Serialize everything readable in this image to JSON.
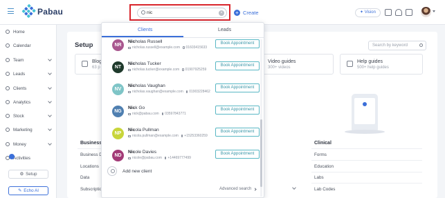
{
  "header": {
    "brand": "Pabau",
    "search_value": "nic",
    "create_label": "Create",
    "vision_label": "Vision"
  },
  "sidebar": {
    "items": [
      {
        "label": "Home",
        "icon": "home-icon",
        "chevron": false
      },
      {
        "label": "Calendar",
        "icon": "calendar-icon",
        "chevron": false
      },
      {
        "label": "Team",
        "icon": "team-icon",
        "chevron": true
      },
      {
        "label": "Leads",
        "icon": "leads-icon",
        "chevron": true
      },
      {
        "label": "Clients",
        "icon": "clients-icon",
        "chevron": true
      },
      {
        "label": "Analytics",
        "icon": "analytics-icon",
        "chevron": true
      },
      {
        "label": "Stock",
        "icon": "stock-icon",
        "chevron": true
      },
      {
        "label": "Marketing",
        "icon": "marketing-icon",
        "chevron": true
      },
      {
        "label": "Money",
        "icon": "money-icon",
        "chevron": true
      },
      {
        "label": "Activities",
        "icon": "activities-icon",
        "chevron": false
      }
    ],
    "activities_badge": "",
    "setup_label": "Setup",
    "echo_label": "Echo AI"
  },
  "main": {
    "title": "Setup",
    "search_placeholder": "Search by keyword",
    "cards": [
      {
        "title": "Blog",
        "subtitle": "63 p"
      },
      {
        "title": "Video guides",
        "subtitle": "300+ videos"
      },
      {
        "title": "Help guides",
        "subtitle": "500+ help guides"
      }
    ],
    "business": {
      "heading": "Business",
      "items": [
        "Business Det",
        "Locations",
        "Data",
        "Subscription"
      ]
    },
    "clinical": {
      "heading": "Clinical",
      "items": [
        "Forms",
        "Education",
        "Labs",
        "Lab Codes"
      ]
    }
  },
  "dropdown": {
    "tabs": [
      "Clients",
      "Leads"
    ],
    "active_tab": "Clients",
    "results": [
      {
        "initials": "NR",
        "color": "#a9578f",
        "match": "Nic",
        "rest": "holas Russell",
        "email": "nicholas.russell@example.com",
        "phone": "01603415633",
        "button": "Book Appointment"
      },
      {
        "initials": "NT",
        "color": "#1f3a2c",
        "match": "Nic",
        "rest": "holas Tucker",
        "email": "nicholas.tucker@example.com",
        "phone": "01907925259",
        "button": "Book Appointment"
      },
      {
        "initials": "NV",
        "color": "#7fc5c7",
        "match": "Nic",
        "rest": "holas Vaughan",
        "email": "nicholas.vaughan@example.com",
        "phone": "01903228462",
        "button": "Book Appointment"
      },
      {
        "initials": "NG",
        "color": "#4f7fb0",
        "match": "Nic",
        "rest": "k Go",
        "email": "nick@pabau.com",
        "phone": "03597843771",
        "button": "Book Appointment"
      },
      {
        "initials": "NP",
        "color": "#c8d53a",
        "match": "Nic",
        "rest": "ola Pullman",
        "email": "nicola.pullman@example.com",
        "phone": "+15253360259",
        "button": "Book Appointment"
      },
      {
        "initials": "ND",
        "color": "#a33b77",
        "match": "Nic",
        "rest": "ole Davies",
        "email": "nicole@pabau.com",
        "phone": "+14469777499",
        "button": "Book Appointment"
      }
    ],
    "add_client_label": "Add new client",
    "advanced_search_label": "Advanced search"
  }
}
